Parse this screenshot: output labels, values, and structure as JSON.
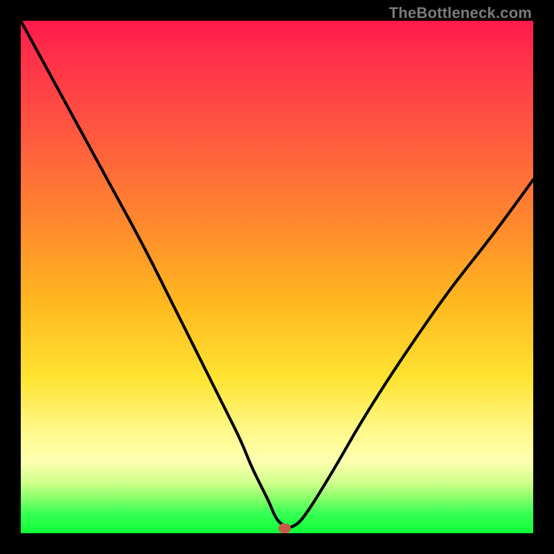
{
  "watermark": "TheBottleneck.com",
  "chart_data": {
    "type": "line",
    "title": "",
    "xlabel": "",
    "ylabel": "",
    "xlim": [
      0,
      100
    ],
    "ylim": [
      0,
      100
    ],
    "series": [
      {
        "name": "bottleneck-curve",
        "x": [
          0,
          6,
          12,
          18,
          24,
          29,
          33,
          37,
          40,
          43,
          45,
          47,
          48.5,
          49.5,
          50.5,
          52,
          53,
          54.5,
          56.5,
          59,
          62,
          66,
          71,
          77,
          84,
          92,
          100
        ],
        "values": [
          100,
          89,
          78,
          67,
          56,
          46,
          38,
          30,
          24,
          18,
          13,
          9,
          6,
          3.5,
          2,
          1.2,
          1.2,
          2.2,
          5,
          9,
          14,
          21,
          29,
          38,
          48,
          58,
          69
        ]
      }
    ],
    "marker": {
      "x": 51.5,
      "y": 1.0,
      "color": "#c65b4a"
    },
    "background": {
      "type": "vertical-gradient",
      "stops": [
        {
          "pos": 0,
          "color": "#ff1a4d"
        },
        {
          "pos": 55,
          "color": "#ffb81f"
        },
        {
          "pos": 80,
          "color": "#fff88a"
        },
        {
          "pos": 100,
          "color": "#0cff38"
        }
      ]
    }
  }
}
